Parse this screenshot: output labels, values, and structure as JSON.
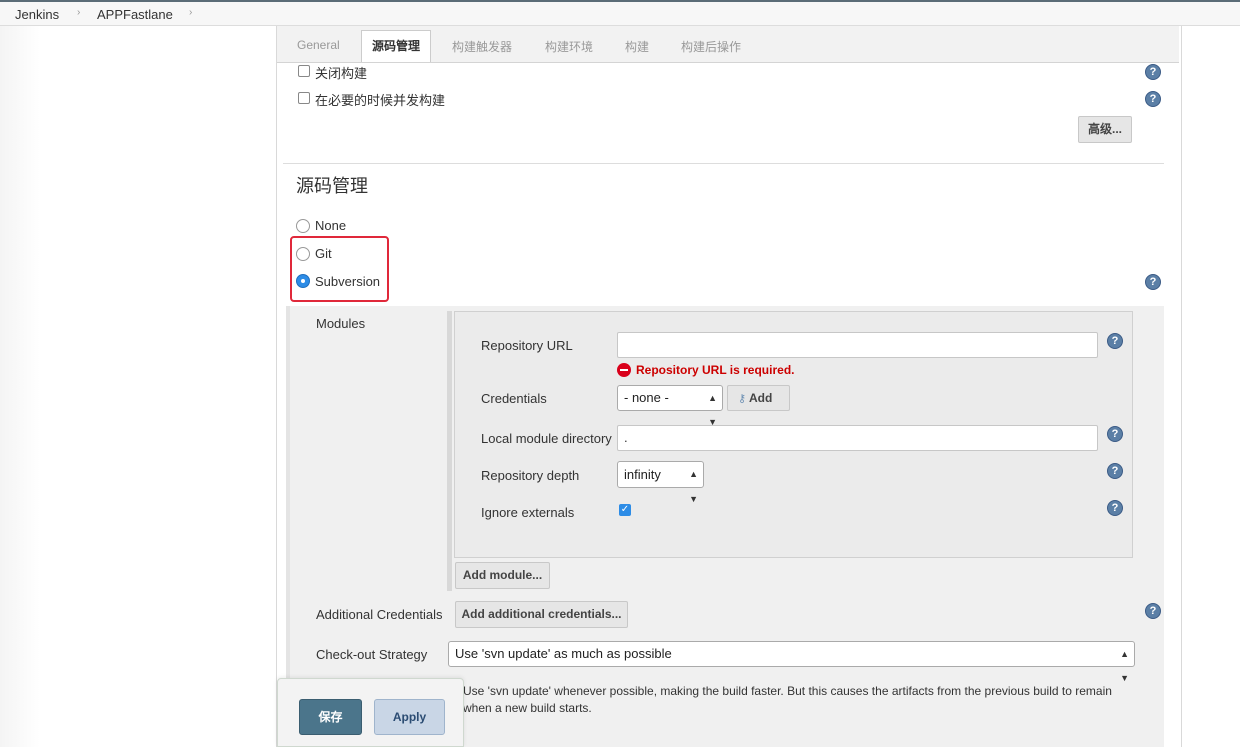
{
  "breadcrumb": {
    "items": [
      "Jenkins",
      "APPFastlane"
    ]
  },
  "tabs": [
    {
      "label": "General"
    },
    {
      "label": "源码管理",
      "active": true
    },
    {
      "label": "构建触发器"
    },
    {
      "label": "构建环境"
    },
    {
      "label": "构建"
    },
    {
      "label": "构建后操作"
    }
  ],
  "general": {
    "disable_build_label": "关闭构建",
    "concurrent_build_label": "在必要的时候并发构建",
    "advanced_button": "高级..."
  },
  "scm": {
    "title": "源码管理",
    "options": [
      "None",
      "Git",
      "Subversion"
    ],
    "selected": "Subversion",
    "modules_label": "Modules",
    "repo_url_label": "Repository URL",
    "repo_url_value": "",
    "repo_url_error": "Repository URL is required.",
    "credentials_label": "Credentials",
    "credentials_value": "- none -",
    "add_button": "Add",
    "local_dir_label": "Local module directory",
    "local_dir_value": ".",
    "depth_label": "Repository depth",
    "depth_value": "infinity",
    "ignore_externals_label": "Ignore externals",
    "ignore_externals_checked": true,
    "add_module_button": "Add module...",
    "additional_credentials_label": "Additional Credentials",
    "add_additional_credentials_button": "Add additional credentials...",
    "checkout_strategy_label": "Check-out Strategy",
    "checkout_strategy_value": "Use 'svn update' as much as possible",
    "checkout_strategy_desc": "Use 'svn update' whenever possible, making the build faster. But this causes the artifacts from the previous build to remain when a new build starts."
  },
  "footer": {
    "save_button": "保存",
    "apply_button": "Apply"
  },
  "colors": {
    "accent": "#2d8ce6",
    "error": "#cc0000",
    "highlight": "#e0283a",
    "save": "#4b758b"
  }
}
